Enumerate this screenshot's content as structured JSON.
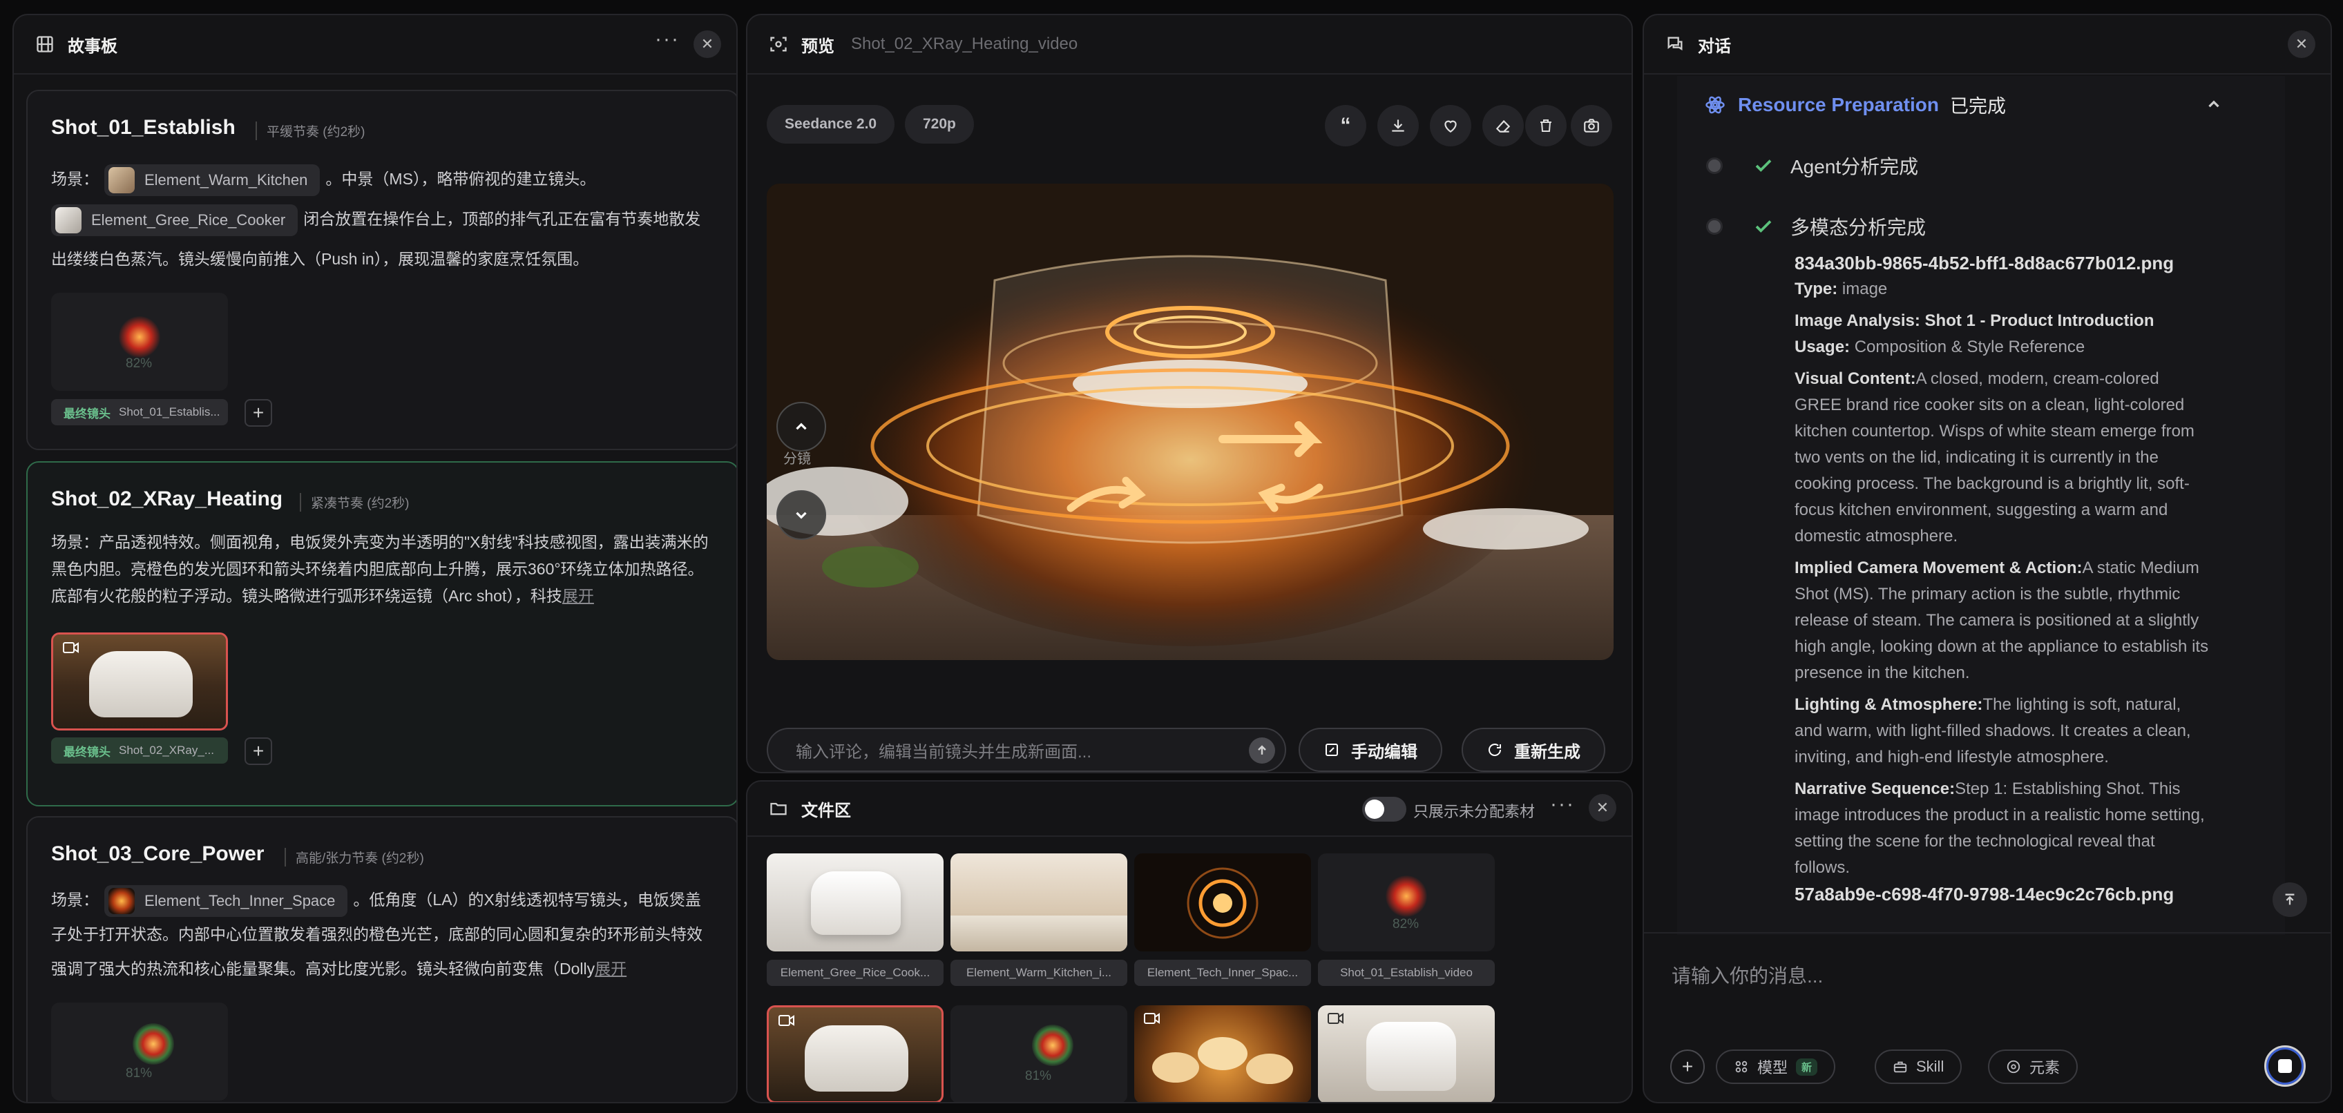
{
  "storyboard": {
    "title": "故事板",
    "shots": [
      {
        "title": "Shot_01_Establish",
        "tag": "平缓节奏 (约2秒)",
        "desc_prefix": "场景：",
        "chip1": "Element_Warm_Kitchen",
        "desc_mid": "。中景（MS），略带俯视的建立镜头。",
        "chip2": "Element_Gree_Rice_Cooker",
        "desc_rest": "闭合放置在操作台上，顶部的排气孔正在富有节奏地散发出缕缕白色蒸汽。镜头缓慢向前推入（Push in），展现温馨的家庭烹饪氛围。",
        "progress": "82%",
        "final_label": "最终镜头",
        "final_name": "Shot_01_Establis..."
      },
      {
        "title": "Shot_02_XRay_Heating",
        "tag": "紧凑节奏 (约2秒)",
        "desc": "场景：产品透视特效。侧面视角，电饭煲外壳变为半透明的\"X射线\"科技感视图，露出装满米的黑色内胆。亮橙色的发光圆环和箭头环绕着内胆底部向上升腾，展示360°环绕立体加热路径。底部有火花般的粒子浮动。镜头略微进行弧形环绕运镜（Arc shot），科技",
        "expand": "展开",
        "final_label": "最终镜头",
        "final_name": "Shot_02_XRay_..."
      },
      {
        "title": "Shot_03_Core_Power",
        "tag": "高能/张力节奏 (约2秒)",
        "desc_prefix": "场景：",
        "chip1": "Element_Tech_Inner_Space",
        "desc_rest": "。低角度（LA）的X射线透视特写镜头，电饭煲盖子处于打开状态。内部中心位置散发着强烈的橙色光芒，底部的同心圆和复杂的环形前头特效强调了强大的热流和核心能量聚集。高对比度光影。镜头轻微向前变焦（Dolly",
        "expand": "展开",
        "progress": "81%"
      }
    ],
    "nav_label": "分镜"
  },
  "preview": {
    "title": "预览",
    "subtitle": "Shot_02_XRay_Heating_video",
    "model": "Seedance 2.0",
    "resolution": "720p",
    "comment_placeholder": "输入评论，编辑当前镜头并生成新画面...",
    "manual_edit": "手动编辑",
    "regenerate": "重新生成"
  },
  "files": {
    "title": "文件区",
    "toggle_label": "只展示未分配素材",
    "tiles": [
      {
        "label": "Element_Gree_Rice_Cook..."
      },
      {
        "label": "Element_Warm_Kitchen_i..."
      },
      {
        "label": "Element_Tech_Inner_Spac..."
      },
      {
        "label": "Shot_01_Establish_video",
        "progress": "82%"
      }
    ],
    "row2_progress": "81%"
  },
  "chat": {
    "title": "对话",
    "resource_title": "Resource Preparation",
    "resource_status": "已完成",
    "step1": "Agent分析完成",
    "step2": "多模态分析完成",
    "file1": "834a30bb-9865-4b52-bff1-8d8ac677b012.png",
    "type_label": "Type:",
    "type_value": "image",
    "analysis_label": "Image Analysis: Shot 1 - Product Introduction",
    "usage_label": "Usage:",
    "usage_value": "Composition & Style Reference",
    "visual_label": "Visual Content:",
    "visual_value": "A closed, modern, cream-colored GREE brand rice cooker sits on a clean, light-colored kitchen countertop. Wisps of white steam emerge from two vents on the lid, indicating it is currently in the cooking process. The background is a brightly lit, soft-focus kitchen environment, suggesting a warm and domestic atmosphere.",
    "camera_label": "Implied Camera Movement & Action:",
    "camera_value": "A static Medium Shot (MS). The primary action is the subtle, rhythmic release of steam. The camera is positioned at a slightly high angle, looking down at the appliance to establish its presence in the kitchen.",
    "lighting_label": "Lighting & Atmosphere:",
    "lighting_value": "The lighting is soft, natural, and warm, with light-filled shadows. It creates a clean, inviting, and high-end lifestyle atmosphere.",
    "narrative_label": "Narrative Sequence:",
    "narrative_value": "Step 1: Establishing Shot. This image introduces the product in a realistic home setting, setting the scene for the technological reveal that follows.",
    "file2": "57a8ab9e-c698-4f70-9798-14ec9c2c76cb.png",
    "input_placeholder": "请输入你的消息...",
    "model_btn": "模型",
    "new_badge": "新",
    "skill_btn": "Skill",
    "element_btn": "元素"
  }
}
